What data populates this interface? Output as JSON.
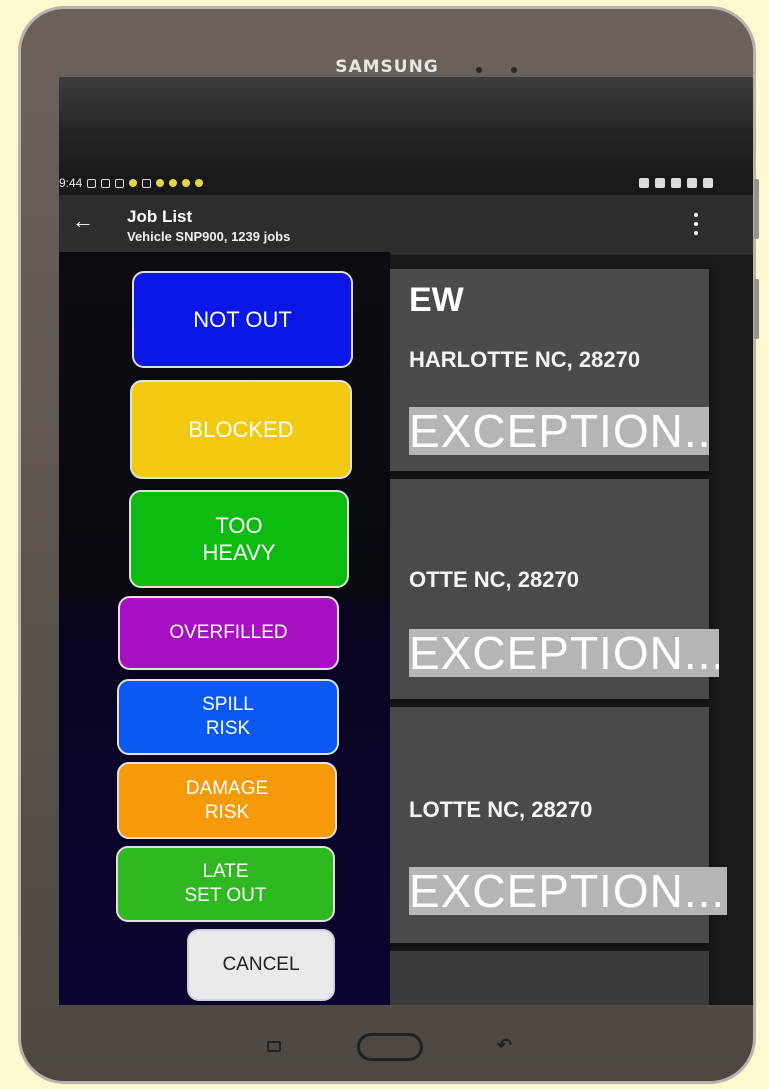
{
  "device": {
    "brand": "SAMSUNG"
  },
  "statusbar": {
    "time": "9:44"
  },
  "appbar": {
    "title": "Job List",
    "subtitle": "Vehicle  SNP900, 1239 jobs"
  },
  "cards": [
    {
      "heading": "EW",
      "address": "HARLOTTE NC, 28270",
      "button": "EXCEPTION..."
    },
    {
      "heading": "",
      "address": "OTTE NC, 28270",
      "button": "EXCEPTION..."
    },
    {
      "heading": "",
      "address": "LOTTE NC, 28270",
      "button": "EXCEPTION..."
    }
  ],
  "exception_options": [
    {
      "line1": "NOT OUT",
      "line2": "",
      "color": "#0a17e6"
    },
    {
      "line1": "BLOCKED",
      "line2": "",
      "color": "#f2c90e"
    },
    {
      "line1": "TOO",
      "line2": "HEAVY",
      "color": "#0dbb10"
    },
    {
      "line1": "OVERFILLED",
      "line2": "",
      "color": "#a80fc2"
    },
    {
      "line1": "SPILL",
      "line2": "RISK",
      "color": "#0b59f5"
    },
    {
      "line1": "DAMAGE",
      "line2": "RISK",
      "color": "#f79a0a"
    },
    {
      "line1": "LATE",
      "line2": "SET OUT",
      "color": "#2fb81f"
    }
  ],
  "cancel": {
    "label": "CANCEL"
  }
}
